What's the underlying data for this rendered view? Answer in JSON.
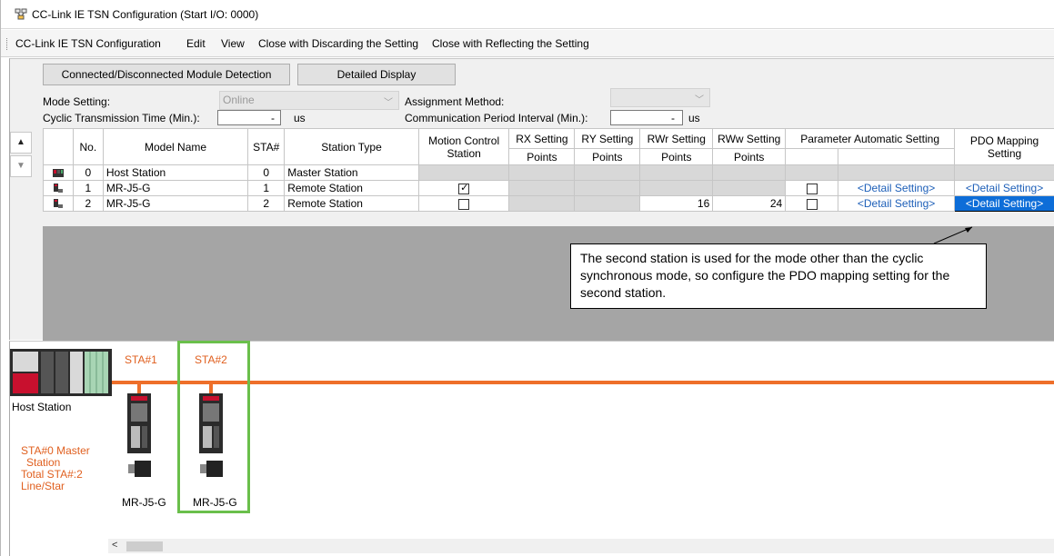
{
  "window": {
    "title": "CC-Link IE TSN Configuration (Start I/O: 0000)"
  },
  "menu": {
    "items": [
      "CC-Link IE TSN Configuration",
      "Edit",
      "View",
      "Close with Discarding the Setting",
      "Close with Reflecting the Setting"
    ]
  },
  "toolbar": {
    "detect_label": "Connected/Disconnected Module Detection",
    "detail_label": "Detailed Display"
  },
  "settings": {
    "mode_label": "Mode Setting:",
    "mode_value": "Online",
    "assignment_label": "Assignment Method:",
    "assignment_value": "",
    "cyclic_label": "Cyclic Transmission Time (Min.):",
    "cyclic_value": "-",
    "cyclic_unit": "us",
    "comm_label": "Communication Period Interval (Min.):",
    "comm_value": "-",
    "comm_unit": "us"
  },
  "table": {
    "headers": {
      "no": "No.",
      "model": "Model Name",
      "sta": "STA#",
      "type": "Station Type",
      "motion": "Motion Control Station",
      "rx": "RX Setting",
      "ry": "RY Setting",
      "rwr": "RWr Setting",
      "rww": "RWw Setting",
      "points": "Points",
      "param": "Parameter Automatic Setting",
      "pdo": "PDO Mapping Setting"
    },
    "rows": [
      {
        "no": "0",
        "model": "Host Station",
        "sta": "0",
        "type": "Master Station",
        "motion": "",
        "rwr": "",
        "rww": "",
        "param_link": "",
        "pdo_link": ""
      },
      {
        "no": "1",
        "model": "MR-J5-G",
        "sta": "1",
        "type": "Remote Station",
        "motion_checked": true,
        "rwr": "",
        "rww": "",
        "param_link": "<Detail Setting>",
        "pdo_link": "<Detail Setting>"
      },
      {
        "no": "2",
        "model": "MR-J5-G",
        "sta": "2",
        "type": "Remote Station",
        "motion_checked": false,
        "rwr": "16",
        "rww": "24",
        "param_link": "<Detail Setting>",
        "pdo_link": "<Detail Setting>"
      }
    ]
  },
  "callout": {
    "text": "The second station is used for the mode other than the cyclic synchronous mode, so configure the PDO mapping setting for the second station."
  },
  "topology": {
    "sta1_label": "STA#1",
    "sta2_label": "STA#2",
    "host_label": "Host Station",
    "summary": [
      "STA#0  Master",
      "Station",
      "Total STA#:2",
      "Line/Star"
    ],
    "device1_label": "MR-J5-G",
    "device2_label": "MR-J5-G"
  },
  "colors": {
    "accent_orange": "#ee6f2a",
    "selection_green": "#6abf4b",
    "selected_cell": "#0d6dd8",
    "link_blue": "#1d5fb8"
  }
}
